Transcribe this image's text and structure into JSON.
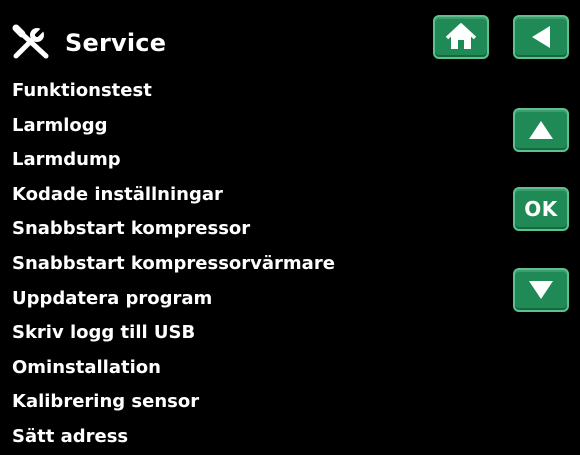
{
  "header": {
    "title": "Service",
    "icon": "tools-icon"
  },
  "buttons": {
    "home_icon": "home-icon",
    "back_icon": "back-arrow-icon",
    "up_icon": "up-arrow-icon",
    "ok_label": "OK",
    "down_icon": "down-arrow-icon"
  },
  "menu": {
    "items": [
      "Funktionstest",
      "Larmlogg",
      "Larmdump",
      "Kodade inställningar",
      "Snabbstart kompressor",
      "Snabbstart kompressorvärmare",
      "Uppdatera program",
      "Skriv logg till USB",
      "Ominstallation",
      "Kalibrering sensor",
      "Sätt adress"
    ]
  },
  "colors": {
    "background": "#000000",
    "button_fill": "#1f8a55",
    "button_border": "#5cc08f",
    "text": "#ffffff"
  }
}
